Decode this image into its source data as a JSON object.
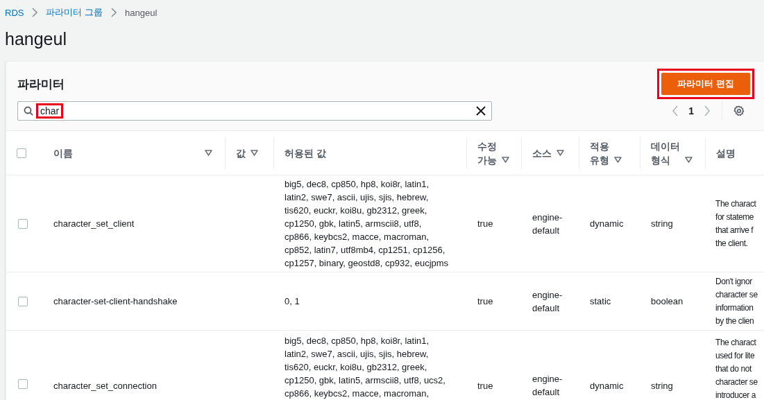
{
  "breadcrumbs": [
    {
      "label": "RDS",
      "link": true
    },
    {
      "label": "파라미터 그룹",
      "link": true
    },
    {
      "label": "hangeul",
      "link": false
    }
  ],
  "title": "hangeul",
  "panel": {
    "title": "파라미터",
    "edit_button": {
      "label": "파라미터 편집",
      "highlighted": true
    },
    "search": {
      "value": "char",
      "highlighted": true
    },
    "pagination": {
      "page": "1"
    }
  },
  "table": {
    "select_all": {
      "checked": false
    },
    "columns": [
      {
        "label": "이름",
        "sortable": true
      },
      {
        "label": "값",
        "sortable": true
      },
      {
        "label": "허용된 값",
        "sortable": false
      },
      {
        "label": "수정\n가능",
        "sortable": true
      },
      {
        "label": "소스",
        "sortable": true
      },
      {
        "label": "적용\n유형",
        "sortable": true
      },
      {
        "label": "데이터\n형식",
        "sortable": true
      },
      {
        "label": "설명",
        "sortable": false
      }
    ],
    "rows": [
      {
        "checked": false,
        "name": "character_set_client",
        "value": "",
        "allowed": "big5, dec8, cp850, hp8, koi8r, latin1,\nlatin2, swe7, ascii, ujis, sjis, hebrew,\ntis620, euckr, koi8u, gb2312, greek,\ncp1250, gbk, latin5, armscii8, utf8,\ncp866, keybcs2, macce, macroman,\ncp852, latin7, utf8mb4, cp1251, cp1256,\ncp1257, binary, geostd8, cp932, eucjpms",
        "editable": "true",
        "source": "engine-\ndefault",
        "apply_type": "dynamic",
        "data_type": "string",
        "description": "The charact\nfor stateme\nthat arrive f\nthe client."
      },
      {
        "checked": false,
        "name": "character-set-client-handshake",
        "value": "",
        "allowed": "0, 1",
        "editable": "true",
        "source": "engine-\ndefault",
        "apply_type": "static",
        "data_type": "boolean",
        "description": "Don't ignor\ncharacter se\ninformation\nby the clien"
      },
      {
        "checked": false,
        "name": "character_set_connection",
        "value": "",
        "allowed": "big5, dec8, cp850, hp8, koi8r, latin1,\nlatin2, swe7, ascii, ujis, sjis, hebrew,\ntis620, euckr, koi8u, gb2312, greek,\ncp1250, gbk, latin5, armscii8, utf8, ucs2,\ncp866, keybcs2, macce, macroman,",
        "editable": "true",
        "source": "engine-\ndefault",
        "apply_type": "dynamic",
        "data_type": "string",
        "description": "The charact\nused for lite\nthat do not\ncharacter se\nintroducer a"
      }
    ]
  }
}
